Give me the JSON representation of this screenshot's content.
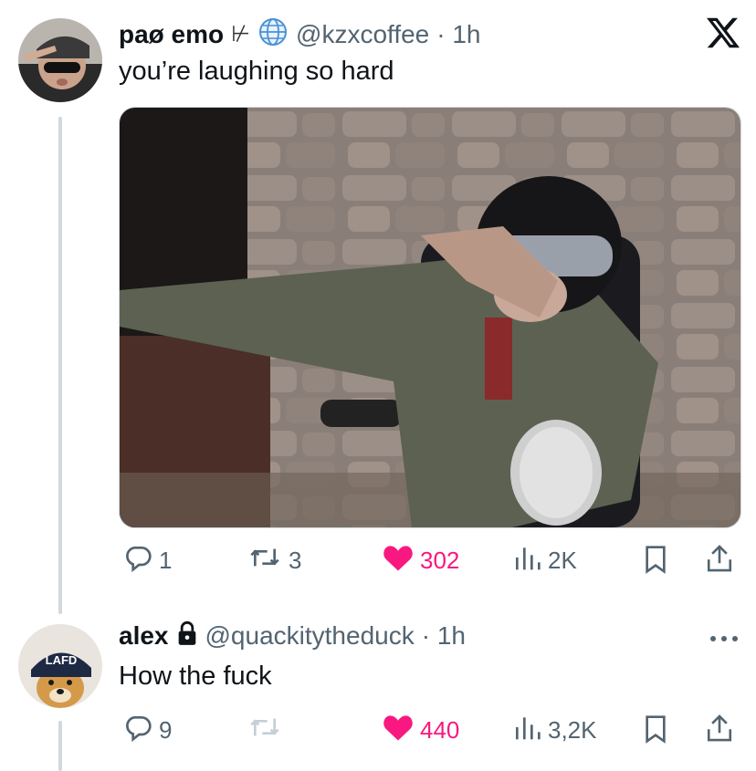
{
  "tweet1": {
    "display_name": "paø emo",
    "emoji": "⊬",
    "handle": "@kzxcoffee",
    "time": "· 1h",
    "text": "you’re laughing so hard",
    "actions": {
      "replies": "1",
      "reposts": "3",
      "likes": "302",
      "views": "2K"
    }
  },
  "tweet2": {
    "display_name": "alex",
    "handle": "@quackitytheduck",
    "time": "· 1h",
    "text": "How the fuck",
    "avatar_badge": "LAFD",
    "actions": {
      "replies": "9",
      "reposts": "",
      "likes": "440",
      "views": "3,2K"
    }
  },
  "colors": {
    "like": "#f91880",
    "muted": "#536471",
    "text": "#0f1419",
    "thread": "#cfd9de"
  },
  "icons": [
    "x-logo-icon",
    "globe-icon",
    "lock-icon",
    "reply-icon",
    "repost-icon",
    "heart-icon",
    "views-icon",
    "bookmark-icon",
    "share-icon",
    "more-icon"
  ]
}
